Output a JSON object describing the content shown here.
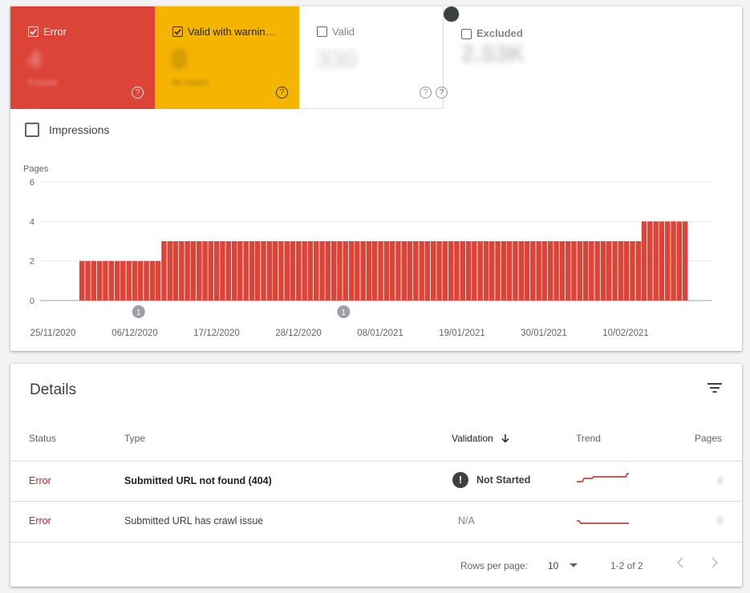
{
  "tiles": [
    {
      "label": "Error",
      "value": "4",
      "sub": "5 issues",
      "checked": true,
      "help": "?"
    },
    {
      "label": "Valid with warnin…",
      "value": "0",
      "sub": "No issues",
      "checked": true,
      "help": "?"
    },
    {
      "label": "Valid",
      "value": "330",
      "sub": "",
      "checked": false,
      "help": "?"
    },
    {
      "label": "Excluded",
      "value": "2.53K",
      "sub": "",
      "checked": false,
      "help": "?"
    }
  ],
  "impressions_label": "Impressions",
  "chart_data": {
    "type": "bar",
    "ylabel": "Pages",
    "ylim": [
      0,
      6
    ],
    "yticks": [
      "0",
      "2",
      "4",
      "6"
    ],
    "xticks": [
      "25/11/2020",
      "06/12/2020",
      "17/12/2020",
      "28/12/2020",
      "08/01/2021",
      "19/01/2021",
      "30/01/2021",
      "10/02/2021"
    ],
    "bar_color": "#db4437",
    "annotations": [
      {
        "after_bar": 6,
        "label": "1"
      },
      {
        "after_bar": 41,
        "label": "1"
      }
    ],
    "values": [
      2,
      2,
      2,
      2,
      2,
      2,
      2,
      2,
      2,
      2,
      2,
      2,
      2,
      2,
      3,
      3,
      3,
      3,
      3,
      3,
      3,
      3,
      3,
      3,
      3,
      3,
      3,
      3,
      3,
      3,
      3,
      3,
      3,
      3,
      3,
      3,
      3,
      3,
      3,
      3,
      3,
      3,
      3,
      3,
      3,
      3,
      3,
      3,
      3,
      3,
      3,
      3,
      3,
      3,
      3,
      3,
      3,
      3,
      3,
      3,
      3,
      3,
      3,
      3,
      3,
      3,
      3,
      3,
      3,
      3,
      3,
      3,
      3,
      3,
      3,
      3,
      3,
      3,
      3,
      3,
      3,
      3,
      3,
      3,
      3,
      3,
      3,
      3,
      3,
      3,
      3,
      3,
      3,
      3,
      3,
      3,
      4,
      4,
      4,
      4,
      4,
      4,
      4,
      4
    ]
  },
  "details": {
    "title": "Details",
    "columns": {
      "status": "Status",
      "type": "Type",
      "validation": "Validation",
      "trend": "Trend",
      "pages": "Pages"
    },
    "rows": [
      {
        "status": "Error",
        "type": "Submitted URL not found (404)",
        "validation": "Not Started",
        "pages": "4"
      },
      {
        "status": "Error",
        "type": "Submitted URL has crawl issue",
        "validation": "N/A",
        "pages": "0"
      }
    ],
    "footer": {
      "rows_per_page_label": "Rows per page:",
      "rows_per_page": "10",
      "range": "1-2 of 2"
    }
  }
}
